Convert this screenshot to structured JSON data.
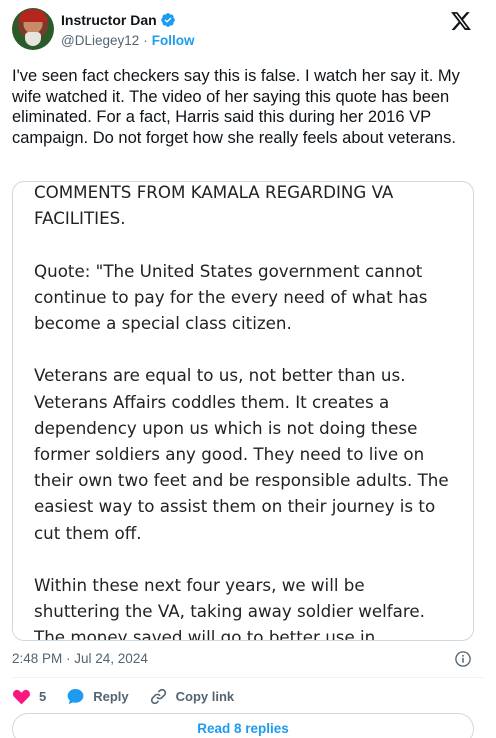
{
  "author": {
    "name": "Instructor Dan",
    "handle": "@DLiegey12",
    "separator": "·",
    "follow_label": "Follow"
  },
  "tweet": {
    "text": "I've seen fact checkers say this is false. I watch her say it. My wife watched it. The video of her saying this quote has been eliminated. For a fact, Harris said this during her 2016 VP campaign. Do not forget how she really feels about veterans."
  },
  "media": {
    "paragraphs": [
      "COMMENTS FROM KAMALA REGARDING VA FACILITIES.",
      "Quote: \"The United States government cannot continue to pay for the every need of what has become a special class citizen.",
      "Veterans are equal to us, not better than us. Veterans Affairs coddles them. It creates a dependency upon us which is not doing these former soldiers any good. They need to live on their own two feet and be responsible adults. The easiest way to assist them on their journey is to cut them off.",
      "Within these next four years, we will be shuttering the VA, taking away soldier welfare. The money saved will go to better use in"
    ]
  },
  "meta": {
    "timestamp": "2:48 PM · Jul 24, 2024"
  },
  "actions": {
    "like_count": "5",
    "reply_label": "Reply",
    "copy_link_label": "Copy link"
  },
  "replies": {
    "label": "Read 8 replies"
  },
  "colors": {
    "accent": "#1d9bf0",
    "like": "#f91880",
    "text": "#0f1419",
    "muted": "#536471",
    "border": "#cfd9de"
  }
}
